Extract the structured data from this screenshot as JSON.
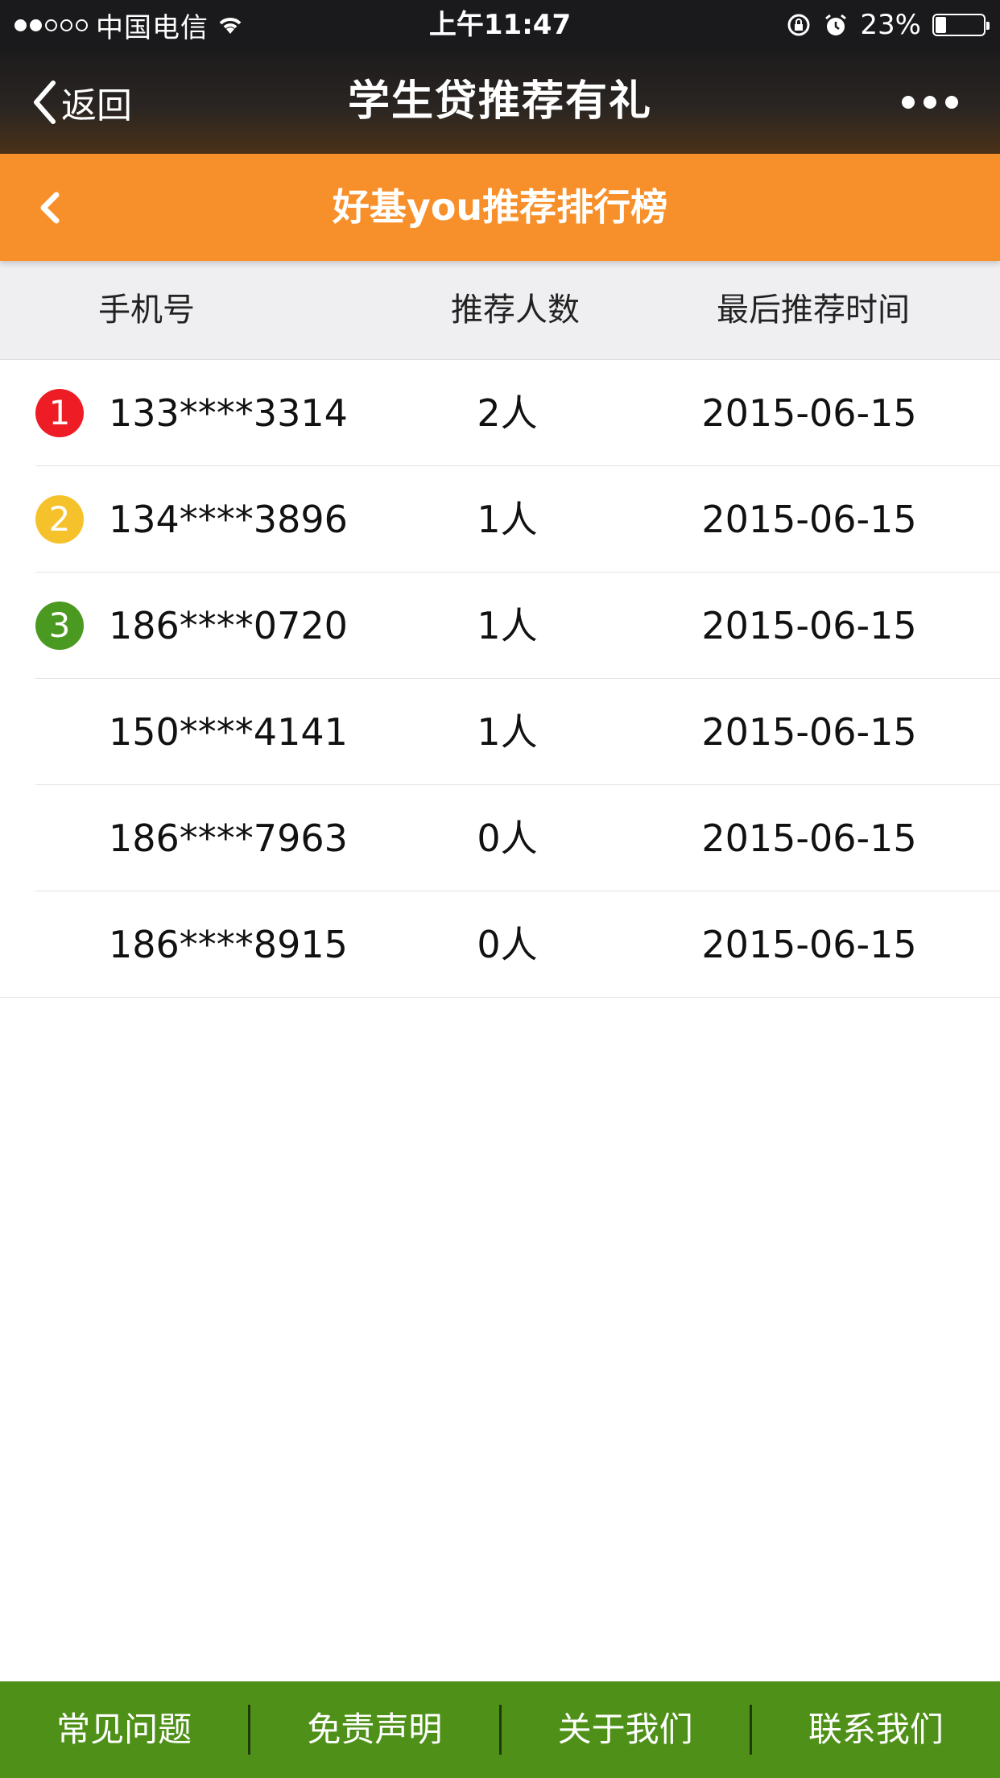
{
  "status_bar": {
    "signal_dots": [
      true,
      true,
      false,
      false,
      false
    ],
    "carrier": "中国电信",
    "time": "上午11:47",
    "battery_text": "23%",
    "battery_level": 0.23
  },
  "nav": {
    "back_label": "返回",
    "title": "学生贷推荐有礼"
  },
  "sub_header": {
    "title": "好基you推荐排行榜"
  },
  "table": {
    "headers": {
      "phone": "手机号",
      "count": "推荐人数",
      "time": "最后推荐时间"
    },
    "rows": [
      {
        "rank": "1",
        "rank_color": "#ee1c25",
        "phone": "133****3314",
        "count": "2人",
        "time": "2015-06-15"
      },
      {
        "rank": "2",
        "rank_color": "#f6c22c",
        "phone": "134****3896",
        "count": "1人",
        "time": "2015-06-15"
      },
      {
        "rank": "3",
        "rank_color": "#4a9a22",
        "phone": "186****0720",
        "count": "1人",
        "time": "2015-06-15"
      },
      {
        "rank": "",
        "rank_color": "",
        "phone": "150****4141",
        "count": "1人",
        "time": "2015-06-15"
      },
      {
        "rank": "",
        "rank_color": "",
        "phone": "186****7963",
        "count": "0人",
        "time": "2015-06-15"
      },
      {
        "rank": "",
        "rank_color": "",
        "phone": "186****8915",
        "count": "0人",
        "time": "2015-06-15"
      }
    ]
  },
  "footer": {
    "items": [
      "常见问题",
      "免责声明",
      "关于我们",
      "联系我们"
    ]
  },
  "colors": {
    "accent_orange": "#f7902a",
    "footer_green": "#4f9118"
  }
}
